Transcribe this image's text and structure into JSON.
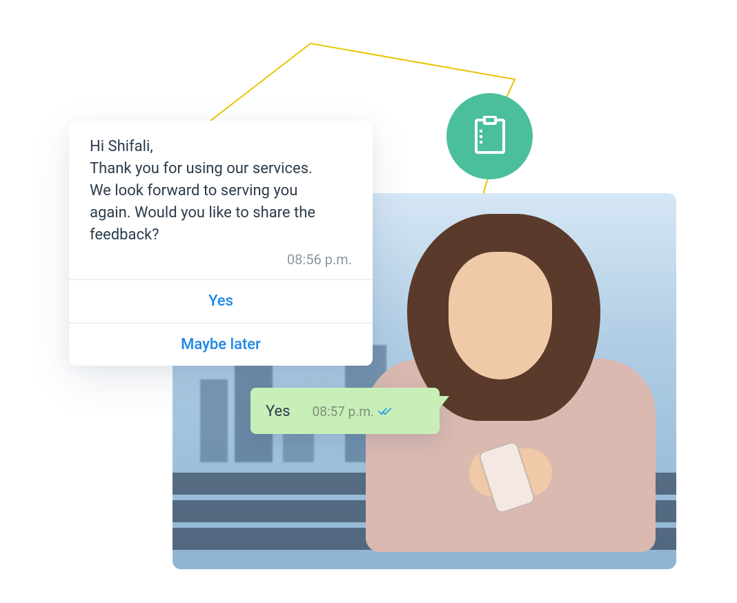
{
  "incoming": {
    "line1": "Hi Shifali,",
    "line2": "Thank you for using our services.",
    "line3": "We look forward to serving you",
    "line4": "again. Would you like to share the",
    "line5": "feedback?",
    "time": "08:56 p.m.",
    "options": {
      "yes": "Yes",
      "later": "Maybe later"
    }
  },
  "outgoing": {
    "text": "Yes",
    "time": "08:57 p.m."
  },
  "icons": {
    "clipboard": "clipboard-icon",
    "read_ticks": "read-ticks-icon"
  },
  "colors": {
    "accent_green": "#4bbf9c",
    "link_blue": "#1c87e6",
    "bubble_green": "#c9efb9",
    "tick_blue": "#3aa0e0",
    "connector_yellow": "#e8c400"
  }
}
